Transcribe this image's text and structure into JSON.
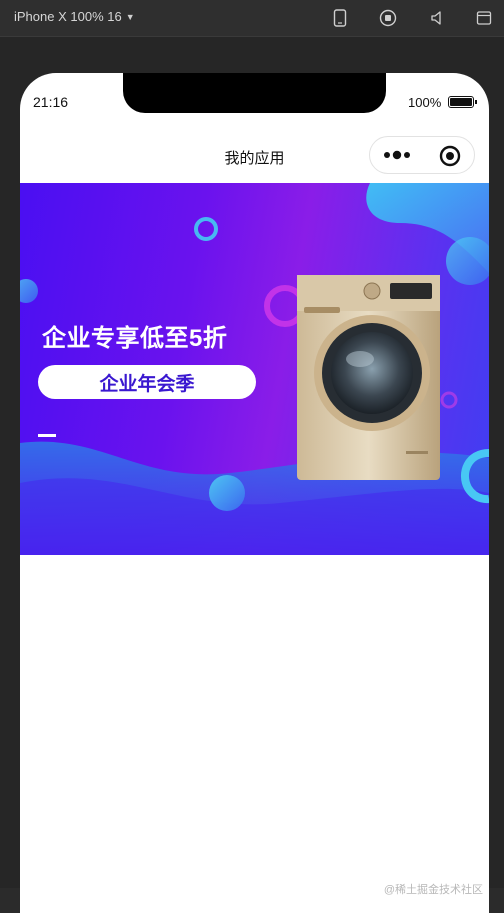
{
  "devtools": {
    "device_label": "iPhone X 100% 16",
    "icons": [
      "phone-icon",
      "record-icon",
      "volume-icon",
      "window-icon"
    ]
  },
  "status_bar": {
    "time": "21:16",
    "battery": "100%"
  },
  "nav_bar": {
    "title": "我的应用"
  },
  "banner": {
    "headline": "企业专享低至5折",
    "button_label": "企业年会季",
    "product": "washing-machine"
  },
  "watermark": "@稀土掘金技术社区",
  "colors": {
    "banner_start": "#4a0ff2",
    "banner_mid": "#8a1de8",
    "banner_end": "#3e3ff2",
    "pill_text": "#3a18d0"
  }
}
